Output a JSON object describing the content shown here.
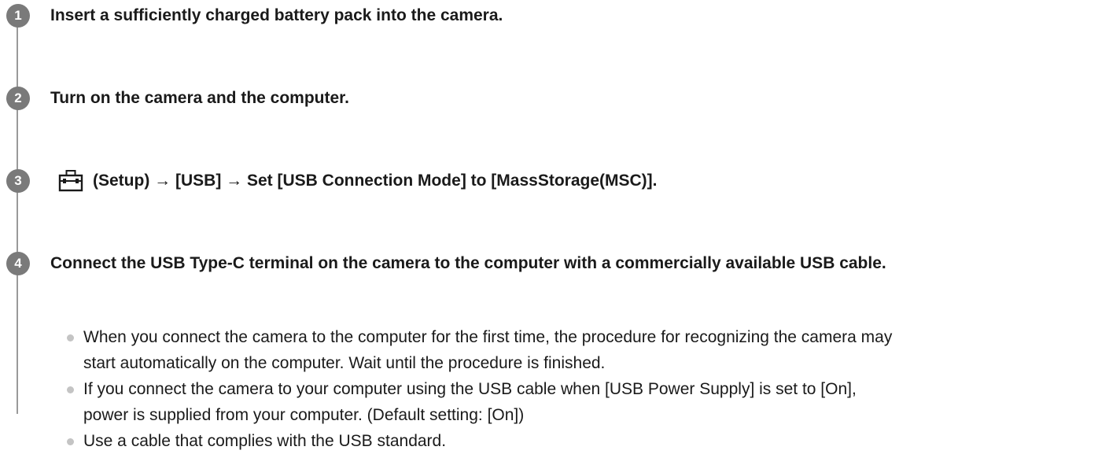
{
  "steps": [
    {
      "number": "1",
      "text": "Insert a sufficiently charged battery pack into the camera."
    },
    {
      "number": "2",
      "text": "Turn on the camera and the computer."
    },
    {
      "number": "3",
      "icon": "toolbox-setup-icon",
      "text": "(Setup) → [USB] → Set [USB Connection Mode] to [MassStorage(MSC)]."
    },
    {
      "number": "4",
      "text": "Connect the USB Type-C terminal on the camera to the computer with a commercially available USB cable."
    }
  ],
  "notes": [
    {
      "lines": [
        "When you connect the camera to the computer for the first time, the procedure for recognizing the camera may",
        "start automatically on the computer. Wait until the procedure is finished."
      ]
    },
    {
      "lines": [
        "If you connect the camera to your computer using the USB cable when [USB Power Supply] is set to [On],",
        "power is supplied from your computer. (Default setting: [On])"
      ]
    },
    {
      "lines": [
        "Use a cable that complies with the USB standard."
      ]
    }
  ],
  "colors": {
    "step_circle": "#7a7a7a",
    "timeline": "#9a9a9a",
    "bullet": "#c4c4c4",
    "text": "#1a1a1a"
  }
}
